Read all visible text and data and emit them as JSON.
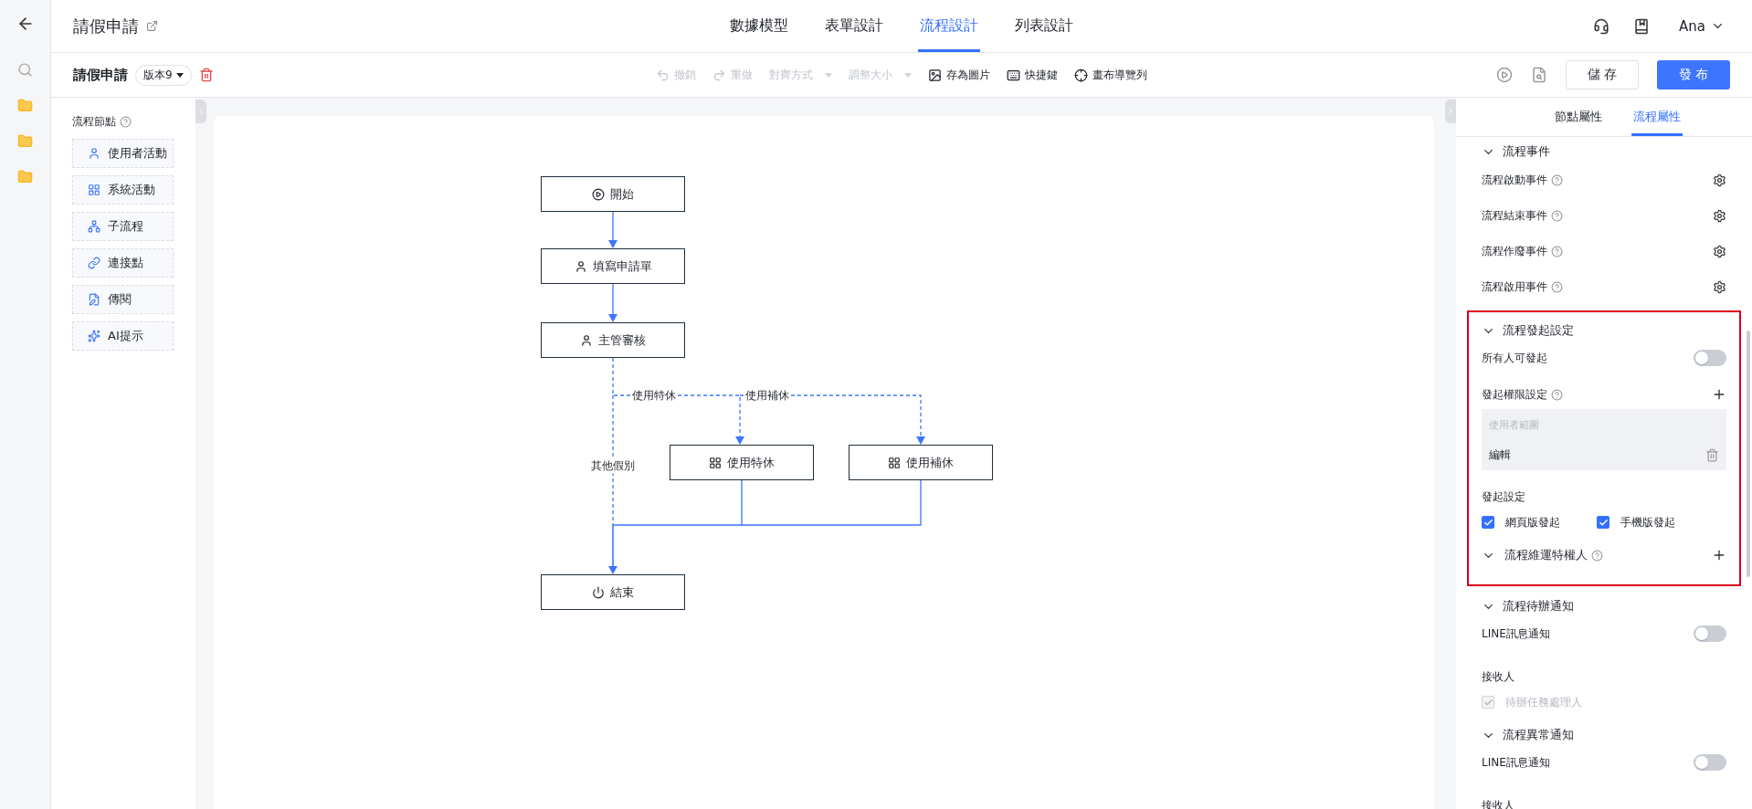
{
  "header": {
    "title": "請假申請",
    "tabs": [
      {
        "label": "數據模型",
        "selected": false
      },
      {
        "label": "表單設計",
        "selected": false
      },
      {
        "label": "流程設計",
        "selected": true
      },
      {
        "label": "列表設計",
        "selected": false
      }
    ],
    "user": "Ana"
  },
  "toolbar": {
    "title": "請假申請",
    "version": "版本9",
    "actions": [
      {
        "kind": "undo",
        "label": "撤銷",
        "disabled": true
      },
      {
        "kind": "redo",
        "label": "重做",
        "disabled": true
      },
      {
        "kind": "dropdown",
        "label": "對齊方式",
        "disabled": true
      },
      {
        "kind": "dropdown",
        "label": "調整大小",
        "disabled": true
      },
      {
        "kind": "image",
        "label": "存為圖片",
        "disabled": false
      },
      {
        "kind": "keyboard",
        "label": "快捷鍵",
        "disabled": false
      },
      {
        "kind": "navigator",
        "label": "畫布導覽列",
        "disabled": false
      }
    ],
    "save": "儲 存",
    "publish": "發 布"
  },
  "node_panel": {
    "title": "流程節點",
    "items": [
      {
        "kind": "user",
        "label": "使用者活動"
      },
      {
        "kind": "system",
        "label": "系統活動"
      },
      {
        "kind": "subflow",
        "label": "子流程"
      },
      {
        "kind": "link",
        "label": "連接點"
      },
      {
        "kind": "circulate",
        "label": "傳閱"
      },
      {
        "kind": "ai",
        "label": "AI提示"
      }
    ]
  },
  "flow": {
    "nodes": [
      {
        "kind": "start",
        "label": "開始"
      },
      {
        "kind": "user",
        "label": "填寫申請單"
      },
      {
        "kind": "user",
        "label": "主管審核"
      },
      {
        "kind": "system",
        "label": "使用特休"
      },
      {
        "kind": "system",
        "label": "使用補休"
      },
      {
        "kind": "end",
        "label": "結束"
      }
    ],
    "branch_labels": [
      "使用特休",
      "使用補休",
      "其他假別"
    ]
  },
  "properties": {
    "tabs": [
      {
        "label": "節點屬性",
        "selected": false
      },
      {
        "label": "流程屬性",
        "selected": true
      }
    ],
    "sections": [
      {
        "title": "流程事件",
        "expanded": true,
        "highlighted": false,
        "rows": [
          {
            "kind": "event",
            "label": "流程啟動事件"
          },
          {
            "kind": "event",
            "label": "流程結束事件"
          },
          {
            "kind": "event",
            "label": "流程作廢事件"
          },
          {
            "kind": "event",
            "label": "流程啟用事件"
          }
        ]
      },
      {
        "title": "流程發起設定",
        "expanded": true,
        "highlighted": true,
        "rows": [
          {
            "kind": "toggle",
            "label": "所有人可發起",
            "on": false
          },
          {
            "kind": "add",
            "label": "發起權限設定"
          },
          {
            "kind": "scope",
            "placeholder": "使用者範圍",
            "value": "編輯"
          },
          {
            "kind": "label",
            "label": "發起設定"
          },
          {
            "kind": "checks",
            "items": [
              {
                "label": "網頁版發起",
                "checked": true,
                "disabled": false
              },
              {
                "label": "手機版發起",
                "checked": true,
                "disabled": false
              }
            ]
          },
          {
            "kind": "subsection",
            "label": "流程維運特權人",
            "expanded": true
          }
        ]
      },
      {
        "title": "流程待辦通知",
        "expanded": true,
        "highlighted": false,
        "rows": [
          {
            "kind": "toggle",
            "label": "LINE訊息通知",
            "on": false
          },
          {
            "kind": "label",
            "label": "接收人"
          },
          {
            "kind": "checks",
            "items": [
              {
                "label": "待辦任務處理人",
                "checked": true,
                "disabled": true
              }
            ]
          }
        ]
      },
      {
        "title": "流程異常通知",
        "expanded": true,
        "highlighted": false,
        "rows": [
          {
            "kind": "toggle",
            "label": "LINE訊息通知",
            "on": false
          },
          {
            "kind": "label",
            "label": "接收人"
          }
        ]
      }
    ]
  }
}
